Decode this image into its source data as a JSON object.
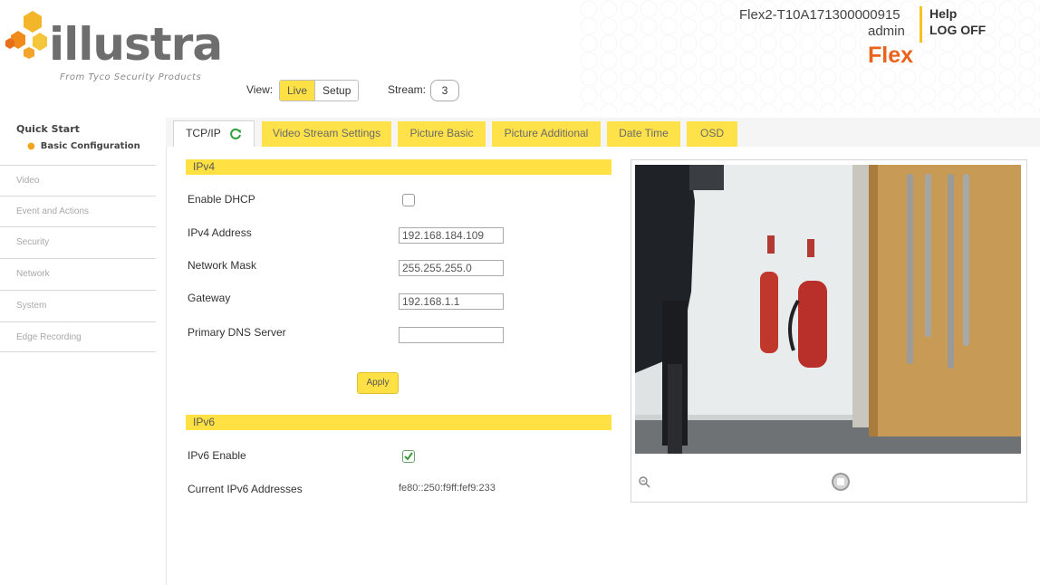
{
  "header": {
    "logo_text": "illustra",
    "logo_tagline": "From Tyco Security Products",
    "device_name": "Flex2-T10A171300000915",
    "user": "admin",
    "help": "Help",
    "log_off": "LOG OFF",
    "product": "Flex"
  },
  "view": {
    "label": "View:",
    "live": "Live",
    "setup": "Setup",
    "stream_label": "Stream:",
    "stream_value": "3"
  },
  "sidebar": {
    "quick_start": "Quick Start",
    "basic_configuration": "Basic Configuration",
    "items": [
      {
        "label": "Video"
      },
      {
        "label": "Event and Actions"
      },
      {
        "label": "Security"
      },
      {
        "label": "Network"
      },
      {
        "label": "System"
      },
      {
        "label": "Edge Recording"
      }
    ]
  },
  "tabs": [
    {
      "label": "TCP/IP",
      "active": true
    },
    {
      "label": "Video Stream Settings",
      "active": false
    },
    {
      "label": "Picture Basic",
      "active": false
    },
    {
      "label": "Picture Additional",
      "active": false
    },
    {
      "label": "Date Time",
      "active": false
    },
    {
      "label": "OSD",
      "active": false
    }
  ],
  "ipv4": {
    "section_title": "IPv4",
    "enable_dhcp_label": "Enable DHCP",
    "enable_dhcp_checked": false,
    "address_label": "IPv4 Address",
    "address_value": "192.168.184.109",
    "mask_label": "Network Mask",
    "mask_value": "255.255.255.0",
    "gateway_label": "Gateway",
    "gateway_value": "192.168.1.1",
    "dns_label": "Primary DNS Server",
    "dns_value": "",
    "apply": "Apply"
  },
  "ipv6": {
    "section_title": "IPv6",
    "enable_label": "IPv6 Enable",
    "enable_checked": true,
    "current_label": "Current IPv6 Addresses",
    "current_value": "fe80::250:f9ff:fef9:233"
  },
  "colors": {
    "accent_yellow": "#ffe143",
    "brand_orange": "#e8631c",
    "refresh_green": "#2e9e3e"
  },
  "icons": [
    "refresh-icon",
    "zoom-icon",
    "record-button-icon",
    "checkbox-check-icon"
  ]
}
